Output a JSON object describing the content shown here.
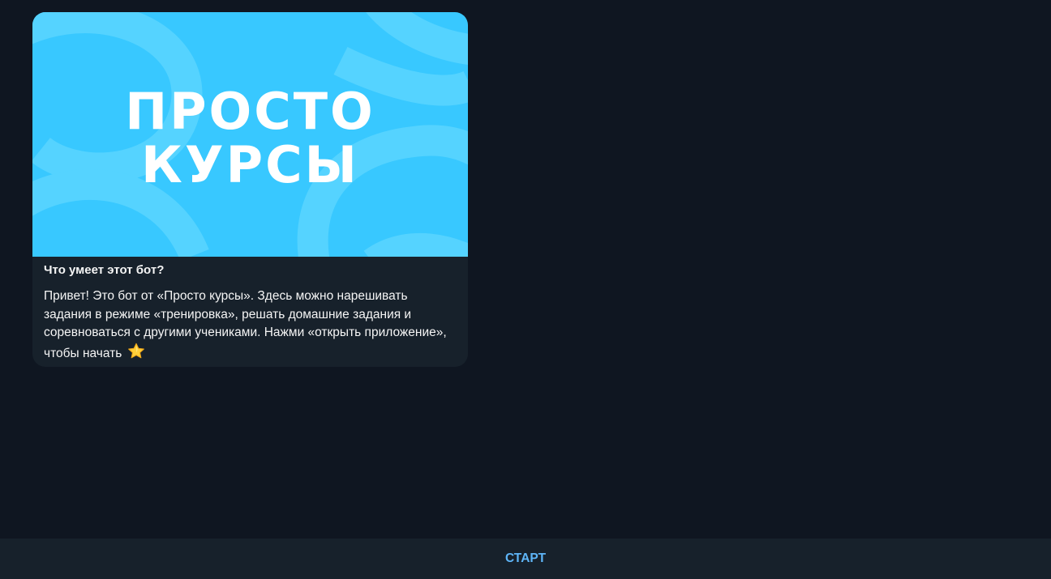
{
  "bot_card": {
    "image": {
      "logo_line1": "ПРОСТО",
      "logo_line2": "КУРСЫ",
      "background_color": "#38c8ff"
    },
    "title": "Что умеет этот бот?",
    "description": "Привет! Это бот от «Просто курсы». Здесь можно нарешивать задания в режиме «тренировка», решать домашние задания и соревноваться с другими учениками. Нажми «открыть приложение», чтобы начать",
    "emoji_icon": "star-icon"
  },
  "bottom_bar": {
    "start_label": "СТАРТ",
    "accent_color": "#5eb5f7"
  },
  "colors": {
    "background": "#0f1621",
    "card": "#17212b",
    "text": "#f5f5f5"
  }
}
